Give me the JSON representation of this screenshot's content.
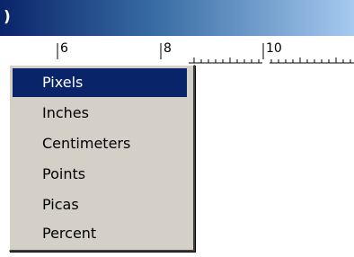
{
  "window": {
    "title_fragment": ")"
  },
  "ruler": {
    "labels": [
      "6",
      "8",
      "10"
    ]
  },
  "units_menu": {
    "selected": "Pixels",
    "items": [
      "Pixels",
      "Inches",
      "Centimeters",
      "Points",
      "Picas",
      "Percent"
    ]
  },
  "colors": {
    "titlebar_start": "#0a246a",
    "titlebar_end": "#a6caf0",
    "menu_background": "#d4d0c8",
    "selection": "#0a246a"
  }
}
